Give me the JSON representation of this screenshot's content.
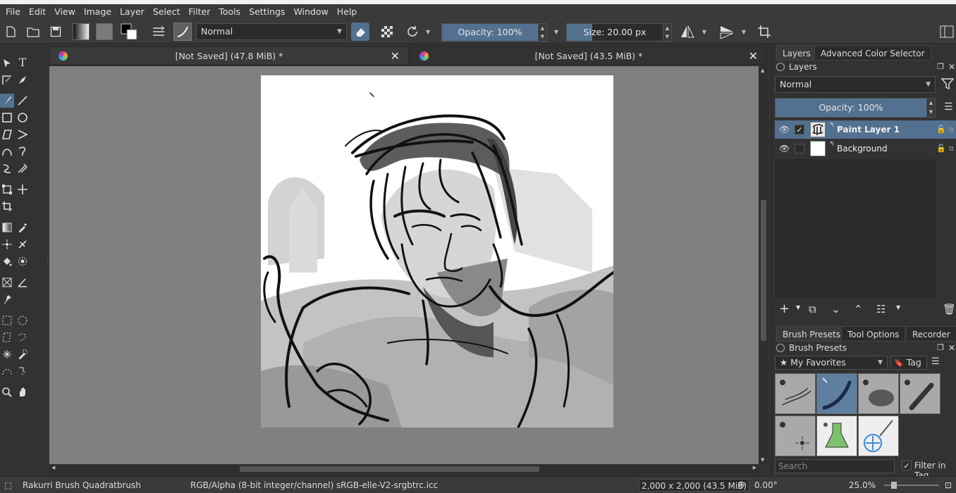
{
  "menu": [
    "File",
    "Edit",
    "View",
    "Image",
    "Layer",
    "Select",
    "Filter",
    "Tools",
    "Settings",
    "Window",
    "Help"
  ],
  "toolbar": {
    "blend_mode": "Normal",
    "opacity_label": "Opacity: 100%",
    "opacity_value": 1.0,
    "size_label": "Size: 20.00 px"
  },
  "documents": [
    {
      "title": "[Not Saved]  (47.8 MiB) *",
      "active": false
    },
    {
      "title": "[Not Saved]  (43.5 MiB) *",
      "active": true
    }
  ],
  "panel_tabs_top": [
    {
      "label": "Layers",
      "active": true
    },
    {
      "label": "Advanced Color Selector",
      "active": false
    }
  ],
  "layers_docker": {
    "title": "Layers",
    "blend_mode": "Normal",
    "opacity_label": "Opacity:  100%",
    "layers": [
      {
        "name": "Paint Layer 1",
        "visible": true,
        "checked": true,
        "selected": true
      },
      {
        "name": "Background",
        "visible": true,
        "checked": false,
        "selected": false
      }
    ]
  },
  "panel_tabs_bottom": [
    {
      "label": "Brush Presets",
      "active": true
    },
    {
      "label": "Tool Options",
      "active": false
    },
    {
      "label": "Recorder",
      "active": false
    }
  ],
  "brush_presets": {
    "title": "Brush Presets",
    "tag_selection": "★ My Favorites",
    "tag_button": "Tag",
    "search_placeholder": "Search",
    "filter_in_tag": "Filter in Tag",
    "filter_in_tag_checked": true,
    "presets": [
      "preset-1",
      "preset-2",
      "preset-3",
      "preset-4",
      "preset-5",
      "preset-6",
      "preset-7"
    ]
  },
  "status": {
    "brush_name": "Rakurri Brush Quadratbrush",
    "color_info": "RGB/Alpha (8-bit integer/channel)  sRGB-elle-V2-srgbtrc.icc",
    "image_size": "2,000 x 2,000 (43.5 MiB)",
    "rotation": "0.00°",
    "zoom": "25.0%"
  }
}
